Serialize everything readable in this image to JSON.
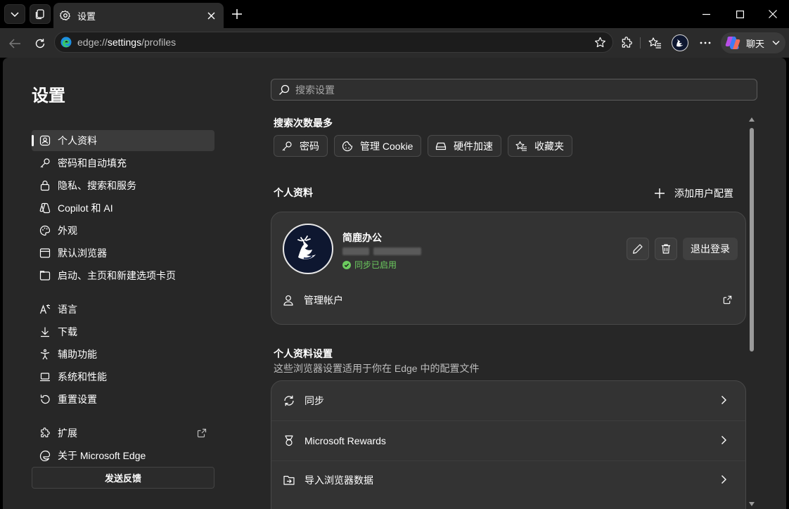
{
  "tab": {
    "title": "设置"
  },
  "address": {
    "scheme": "edge://",
    "host": "settings",
    "path": "/profiles"
  },
  "toolbar": {
    "copilot_label": "聊天"
  },
  "sidebar": {
    "title": "设置",
    "items": [
      {
        "label": "个人资料",
        "icon": "profile-icon"
      },
      {
        "label": "密码和自动填充",
        "icon": "key-icon"
      },
      {
        "label": "隐私、搜索和服务",
        "icon": "lock-icon"
      },
      {
        "label": "Copilot 和 AI",
        "icon": "copilot-icon"
      },
      {
        "label": "外观",
        "icon": "palette-icon"
      },
      {
        "label": "默认浏览器",
        "icon": "browser-icon"
      },
      {
        "label": "启动、主页和新建选项卡页",
        "icon": "home-icon"
      },
      {
        "label": "语言",
        "icon": "language-icon"
      },
      {
        "label": "下载",
        "icon": "download-icon"
      },
      {
        "label": "辅助功能",
        "icon": "accessibility-icon"
      },
      {
        "label": "系统和性能",
        "icon": "laptop-icon"
      },
      {
        "label": "重置设置",
        "icon": "reset-icon"
      },
      {
        "label": "扩展",
        "icon": "extension-icon"
      },
      {
        "label": "关于 Microsoft Edge",
        "icon": "edge-logo-icon"
      }
    ],
    "feedback_label": "发送反馈"
  },
  "search": {
    "placeholder": "搜索设置"
  },
  "most_searched": {
    "title": "搜索次数最多",
    "chips": [
      {
        "label": "密码",
        "icon": "key-icon"
      },
      {
        "label": "管理 Cookie",
        "icon": "cookie-icon"
      },
      {
        "label": "硬件加速",
        "icon": "hardware-icon"
      },
      {
        "label": "收藏夹",
        "icon": "favorites-icon"
      }
    ]
  },
  "profiles": {
    "title": "个人资料",
    "add_label": "添加用户配置",
    "profile_name": "简鹿办公",
    "sync_status": "同步已启用",
    "signout_label": "退出登录",
    "manage_label": "管理帐户"
  },
  "profile_settings": {
    "title": "个人资料设置",
    "subtitle": "这些浏览器设置适用于你在 Edge 中的配置文件",
    "rows": [
      {
        "label": "同步",
        "icon": "sync-icon"
      },
      {
        "label": "Microsoft Rewards",
        "icon": "rewards-icon"
      },
      {
        "label": "导入浏览器数据",
        "icon": "import-icon"
      }
    ]
  }
}
